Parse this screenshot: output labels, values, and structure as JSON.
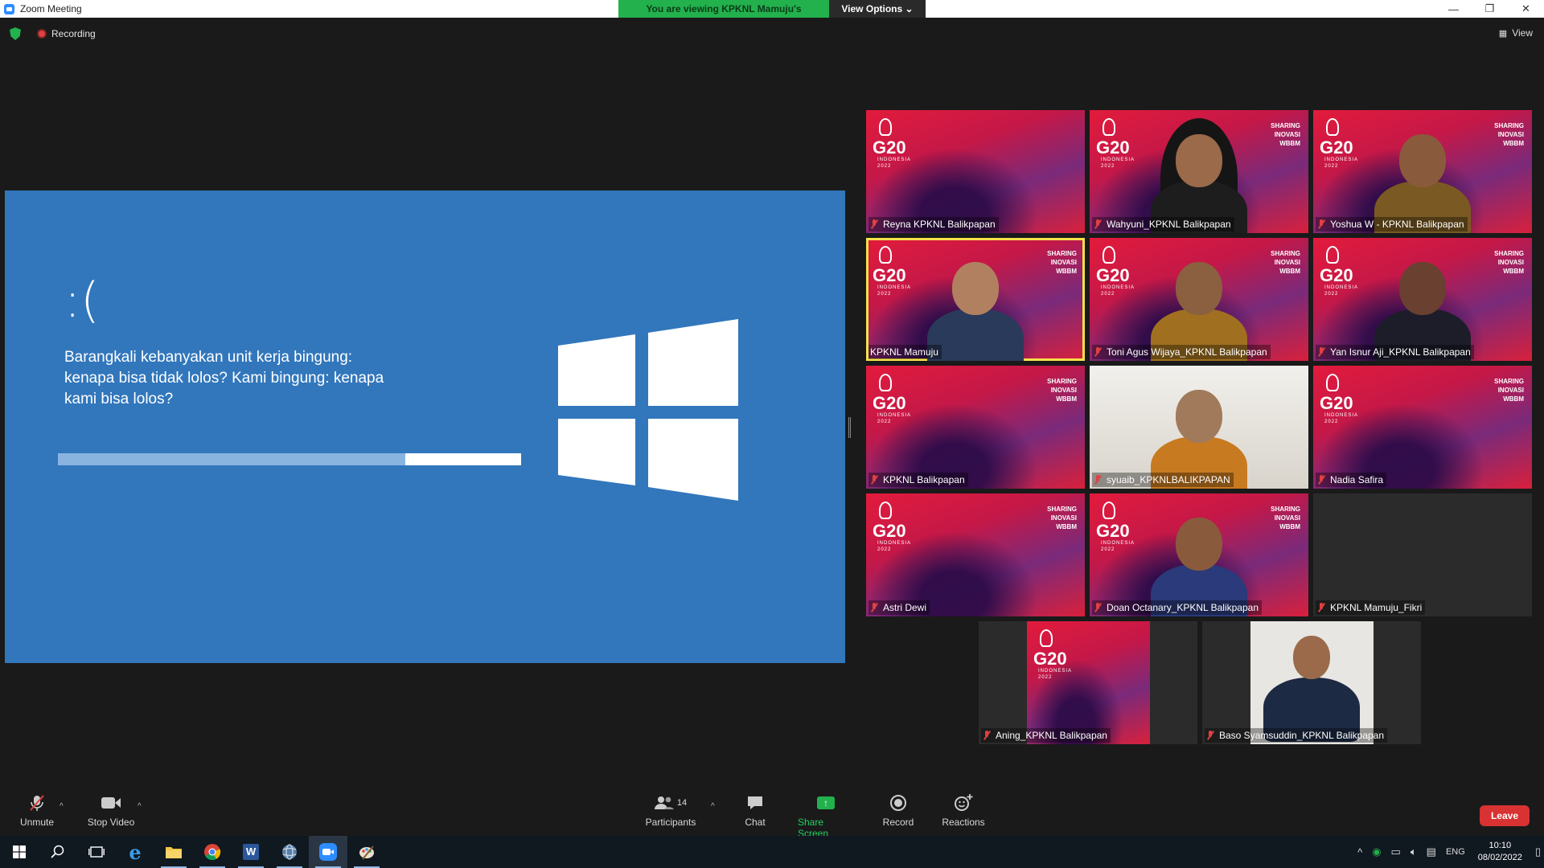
{
  "window": {
    "title": "Zoom Meeting",
    "banner_text": "You are viewing KPKNL Mamuju's screen",
    "view_options": "View Options",
    "minimize": "—",
    "restore": "❐",
    "close": "✕"
  },
  "status": {
    "recording": "Recording",
    "view": "View"
  },
  "shared_screen": {
    "emoticon": ":(",
    "message": "Barangkali kebanyakan unit kerja bingung: kenapa bisa tidak lolos? Kami bingung: kenapa kami bisa lolos?",
    "progress": 0.75
  },
  "g20_logo": {
    "text": "G20",
    "sub": "INDONESIA",
    "year": "2022",
    "sharing": [
      "SHARING",
      "INOVASI",
      "WBBM"
    ]
  },
  "participants": [
    {
      "name": "Reyna KPKNL Balikpapan",
      "has_person": false
    },
    {
      "name": "Wahyuni_KPKNL Balikpapan",
      "has_person": true
    },
    {
      "name": "Yoshua W - KPKNL Balikpapan",
      "has_person": true
    },
    {
      "name": "KPKNL Mamuju",
      "has_person": true,
      "active": true
    },
    {
      "name": "Toni Agus Wijaya_KPKNL Balikpapan",
      "has_person": true
    },
    {
      "name": "Yan Isnur Aji_KPKNL Balikpapan",
      "has_person": true
    },
    {
      "name": "KPKNL Balikpapan",
      "has_person": false
    },
    {
      "name": "syuaib_KPKNLBALIKPAPAN",
      "has_person": true
    },
    {
      "name": "Nadia Safira",
      "has_person": false
    },
    {
      "name": "Astri Dewi",
      "has_person": false
    },
    {
      "name": "Doan Octanary_KPKNL Balikpapan",
      "has_person": true
    },
    {
      "name": "KPKNL Mamuju_Fikri",
      "has_person": false
    },
    {
      "name": "Aning_KPKNL Balikpapan",
      "has_person": false
    },
    {
      "name": "Baso Syamsuddin_KPKNL Balikpapan",
      "has_person": true
    }
  ],
  "toolbar": {
    "unmute": "Unmute",
    "stop_video": "Stop Video",
    "participants": "Participants",
    "participant_count": "14",
    "chat": "Chat",
    "share_screen": "Share Screen",
    "record": "Record",
    "reactions": "Reactions",
    "leave": "Leave"
  },
  "taskbar": {
    "language": "ENG",
    "time": "10:10",
    "date": "08/02/2022"
  },
  "colors": {
    "zoom_blue": "#2d8cff",
    "banner_green": "#23b14d",
    "bsod_blue": "#3277bc",
    "active_speaker": "#f5e24a",
    "leave_red": "#d83232",
    "muted_red": "#e04141"
  }
}
